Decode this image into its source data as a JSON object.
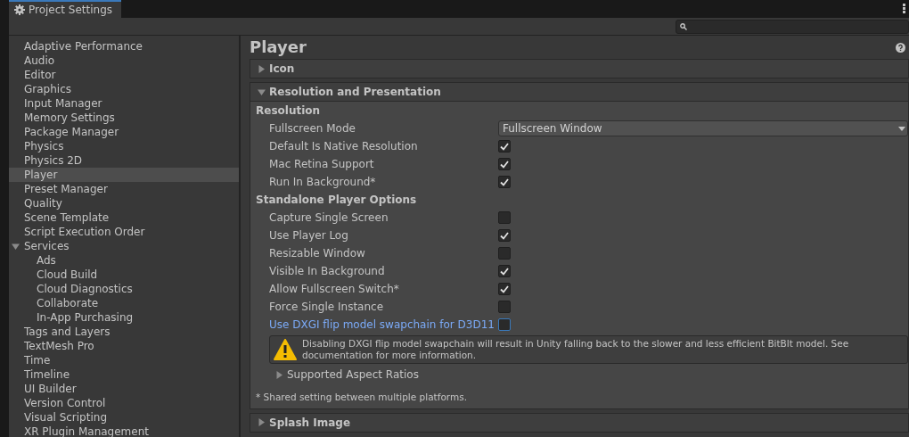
{
  "window": {
    "title": "Project Settings"
  },
  "sidebar": {
    "items": [
      {
        "label": "Adaptive Performance",
        "selected": false
      },
      {
        "label": "Audio",
        "selected": false
      },
      {
        "label": "Editor",
        "selected": false
      },
      {
        "label": "Graphics",
        "selected": false
      },
      {
        "label": "Input Manager",
        "selected": false
      },
      {
        "label": "Memory Settings",
        "selected": false
      },
      {
        "label": "Package Manager",
        "selected": false
      },
      {
        "label": "Physics",
        "selected": false
      },
      {
        "label": "Physics 2D",
        "selected": false
      },
      {
        "label": "Player",
        "selected": true
      },
      {
        "label": "Preset Manager",
        "selected": false
      },
      {
        "label": "Quality",
        "selected": false
      },
      {
        "label": "Scene Template",
        "selected": false
      },
      {
        "label": "Script Execution Order",
        "selected": false
      },
      {
        "label": "Services",
        "selected": false,
        "expanded": true,
        "children": [
          {
            "label": "Ads",
            "selected": false
          },
          {
            "label": "Cloud Build",
            "selected": false
          },
          {
            "label": "Cloud Diagnostics",
            "selected": false
          },
          {
            "label": "Collaborate",
            "selected": false
          },
          {
            "label": "In-App Purchasing",
            "selected": false
          }
        ]
      },
      {
        "label": "Tags and Layers",
        "selected": false
      },
      {
        "label": "TextMesh Pro",
        "selected": false
      },
      {
        "label": "Time",
        "selected": false
      },
      {
        "label": "Timeline",
        "selected": false
      },
      {
        "label": "UI Builder",
        "selected": false
      },
      {
        "label": "Version Control",
        "selected": false
      },
      {
        "label": "Visual Scripting",
        "selected": false
      },
      {
        "label": "XR Plugin Management",
        "selected": false
      }
    ]
  },
  "panel": {
    "title": "Player",
    "sections": [
      {
        "title": "Icon",
        "expanded": false
      },
      {
        "title": "Resolution and Presentation",
        "expanded": true,
        "groups": [
          {
            "heading": "Resolution",
            "rows": [
              {
                "kind": "dropdown",
                "label": "Fullscreen Mode",
                "value": "Fullscreen Window",
                "focused": false
              },
              {
                "kind": "checkbox",
                "label": "Default Is Native Resolution",
                "checked": true,
                "focused": false
              },
              {
                "kind": "checkbox",
                "label": "Mac Retina Support",
                "checked": true,
                "focused": false
              },
              {
                "kind": "checkbox",
                "label": "Run In Background*",
                "checked": true,
                "focused": false
              }
            ]
          },
          {
            "heading": "Standalone Player Options",
            "rows": [
              {
                "kind": "checkbox",
                "label": "Capture Single Screen",
                "checked": false,
                "focused": false
              },
              {
                "kind": "checkbox",
                "label": "Use Player Log",
                "checked": true,
                "focused": false
              },
              {
                "kind": "checkbox",
                "label": "Resizable Window",
                "checked": false,
                "focused": false
              },
              {
                "kind": "checkbox",
                "label": "Visible In Background",
                "checked": true,
                "focused": false
              },
              {
                "kind": "checkbox",
                "label": "Allow Fullscreen Switch*",
                "checked": true,
                "focused": false
              },
              {
                "kind": "checkbox",
                "label": "Force Single Instance",
                "checked": false,
                "focused": false
              },
              {
                "kind": "checkbox",
                "label": "Use DXGI flip model swapchain for D3D11",
                "checked": false,
                "focused": true
              }
            ]
          }
        ],
        "warning": "Disabling DXGI flip model swapchain will result in Unity falling back to the slower and less efficient BitBlt model. See documentation for more information.",
        "foldout": {
          "title": "Supported Aspect Ratios",
          "expanded": false
        },
        "footnote": "* Shared setting between multiple platforms."
      },
      {
        "title": "Splash Image",
        "expanded": false
      }
    ]
  }
}
